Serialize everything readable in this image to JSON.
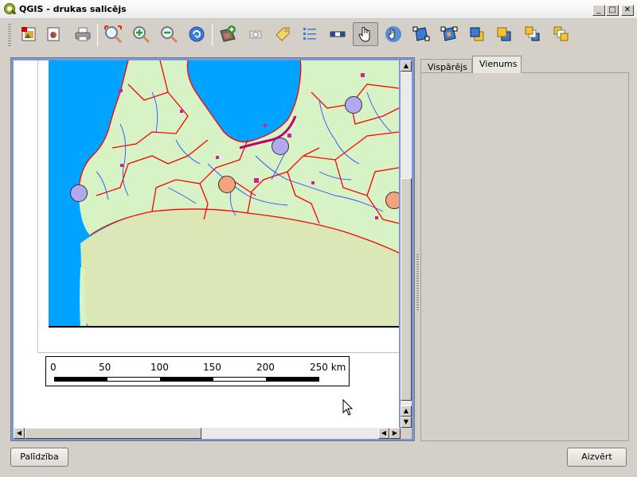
{
  "window": {
    "title": "QGIS - drukas salicējs"
  },
  "toolbar": {
    "icons": [
      "export-image",
      "export-svg",
      "print",
      "zoom-full",
      "zoom-in",
      "zoom-out",
      "refresh",
      "add-map",
      "add-image",
      "add-label",
      "add-legend",
      "add-scalebar",
      "select-move",
      "move-content",
      "group",
      "ungroup",
      "raise",
      "lower",
      "move-to-top",
      "move-to-bottom"
    ]
  },
  "scalebar": {
    "labels": [
      "0",
      "50",
      "100",
      "150",
      "200",
      "250 km"
    ]
  },
  "tabs": {
    "general": "Vispārējs",
    "item": "Vienums"
  },
  "buttons": {
    "help": "Palīdzība",
    "close": "Aizvērt"
  },
  "colors": {
    "sea": "#00a3ff",
    "land": "#d7f2c4",
    "neighbor": "#dbe7b5",
    "border": "#ff0000",
    "river": "#3050ff",
    "city_purple": "#b0a9f0",
    "city_orange": "#f4a37e"
  }
}
